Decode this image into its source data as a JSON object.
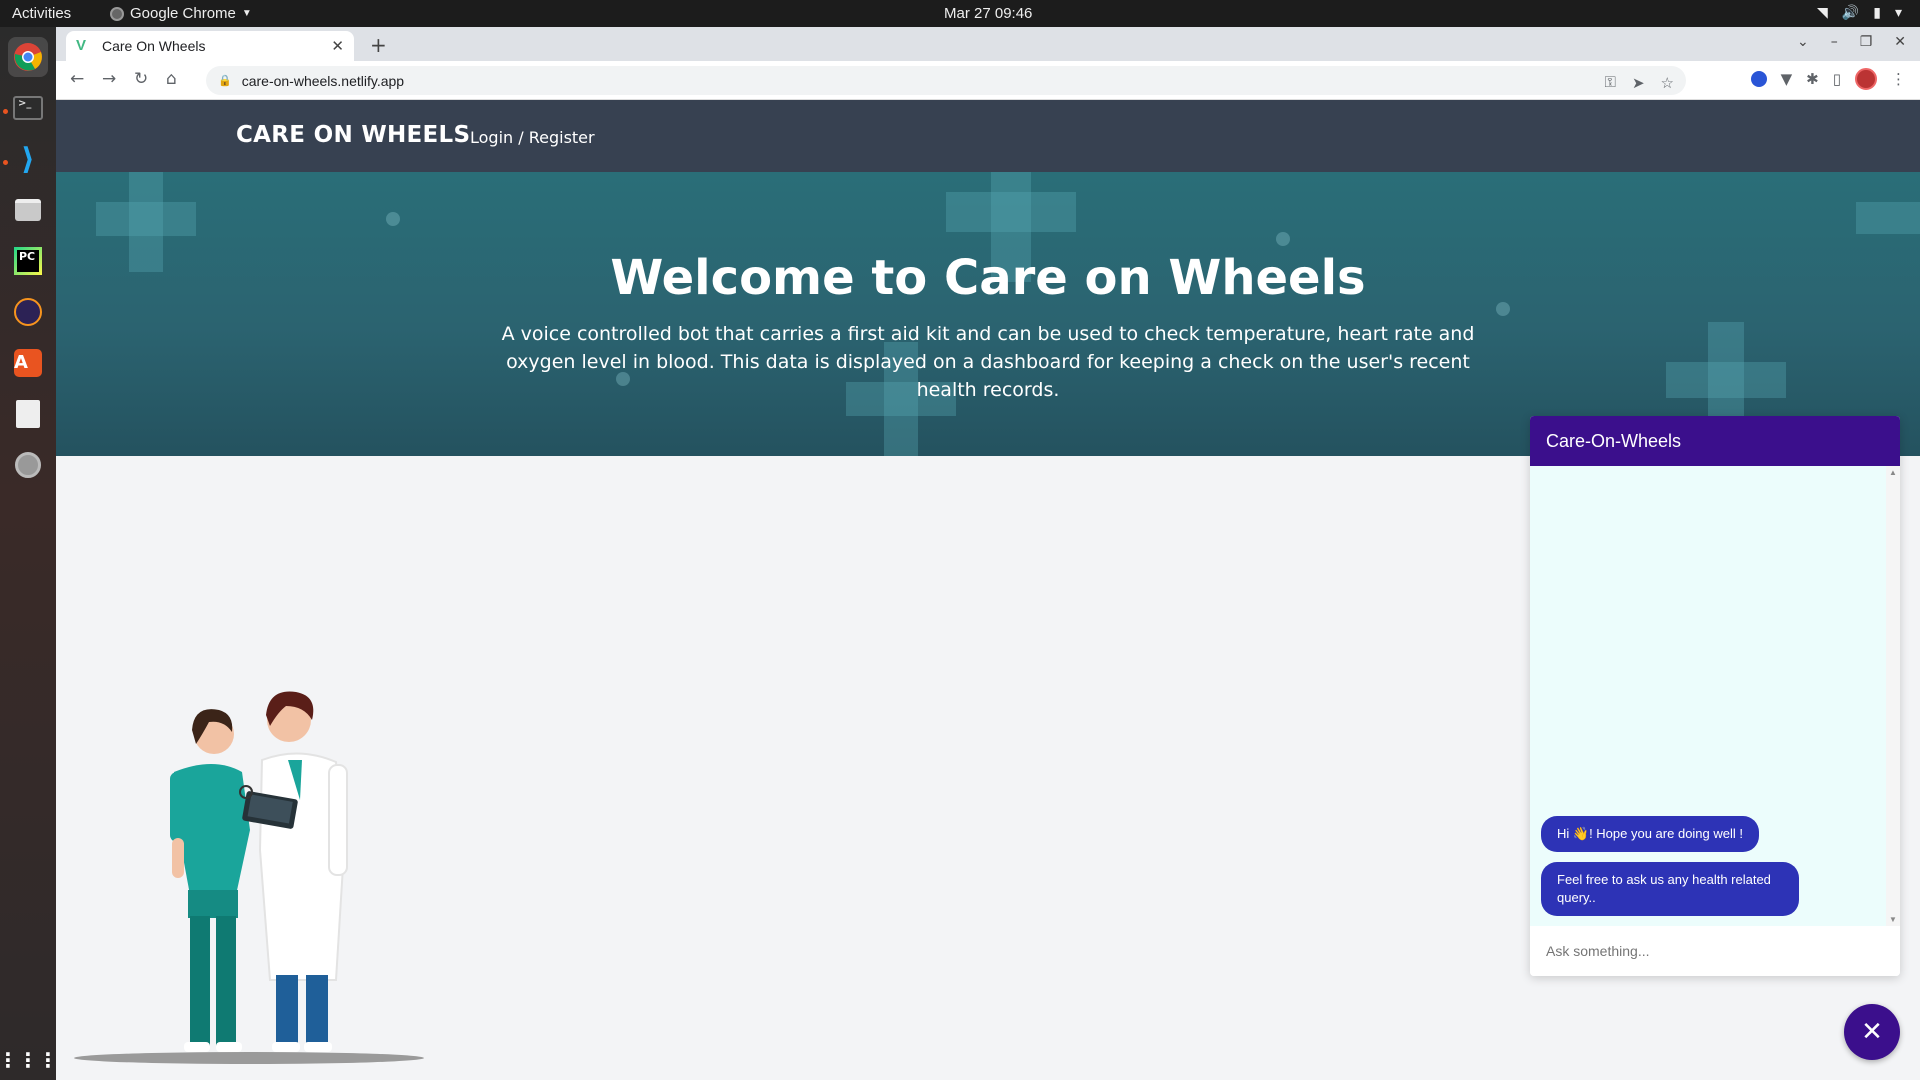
{
  "system": {
    "activities": "Activities",
    "app_name": "Google Chrome",
    "clock": "Mar 27  09:46"
  },
  "browser": {
    "tab_title": "Care On Wheels",
    "url": "care-on-wheels.netlify.app"
  },
  "site": {
    "brand": "CARE ON WHEELS",
    "nav_link": "Login / Register",
    "hero_title": "Welcome to Care on Wheels",
    "hero_subtitle": "A voice controlled bot that carries a first aid kit and can be used to check temperature, heart rate and oxygen level in blood. This data is displayed on a dashboard for keeping a check on the user's recent health records."
  },
  "chat": {
    "title": "Care-On-Wheels",
    "messages": [
      "Hi 👋! Hope you are doing well !",
      "Feel free to ask us any health related query.."
    ],
    "input_placeholder": "Ask something...",
    "close_icon": "✕"
  },
  "colors": {
    "nav_bg": "#374151",
    "hero_bg": "#2b6370",
    "chat_header": "#3b0f8c",
    "chat_bubble": "#2d33b6",
    "chat_body": "#ecfdfc"
  },
  "icons": {
    "dock": [
      "chrome-icon",
      "terminal-icon",
      "vscode-icon",
      "files-icon",
      "pycharm-icon",
      "eclipse-icon",
      "software-center-icon",
      "document-viewer-icon",
      "disk-icon",
      "app-grid-icon"
    ]
  }
}
